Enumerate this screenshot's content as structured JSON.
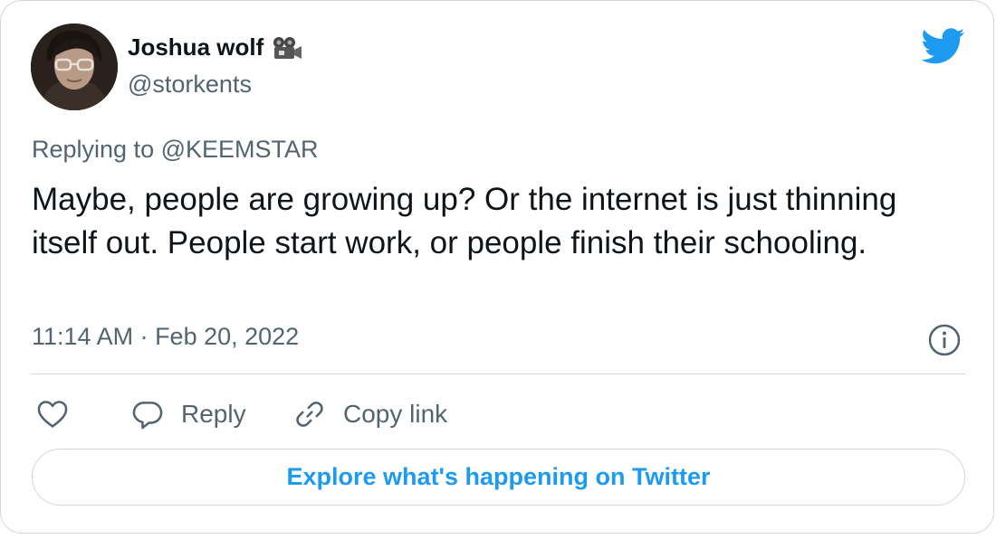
{
  "author": {
    "name": "Joshua wolf",
    "name_emoji_icon": "movie-camera-icon",
    "handle": "@storkents"
  },
  "brand_icon": "twitter-bird-icon",
  "colors": {
    "brand": "#1d9bf0",
    "text_primary": "#0f1419",
    "text_secondary": "#536471",
    "border": "#cfd9de"
  },
  "tweet": {
    "replying_prefix": "Replying to",
    "replying_to": "@KEEMSTAR",
    "text": "Maybe, people are growing up? Or the internet is just thinning itself out. People start work, or people finish their schooling.",
    "timestamp": "11:14 AM · Feb 20, 2022"
  },
  "actions": {
    "like_icon": "heart-icon",
    "reply_label": "Reply",
    "copy_label": "Copy link"
  },
  "explore_label": "Explore what's happening on Twitter"
}
